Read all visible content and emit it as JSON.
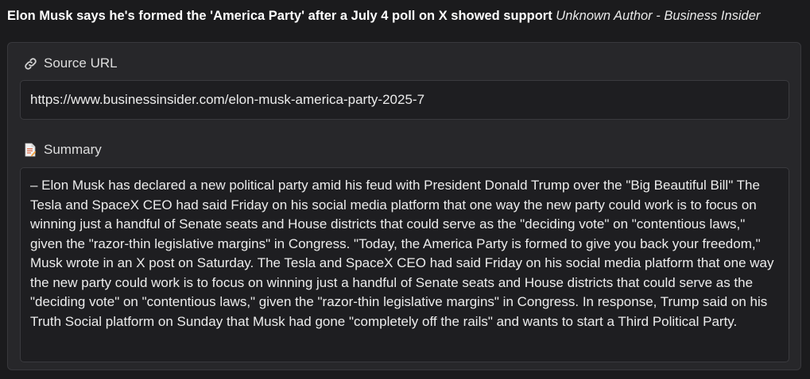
{
  "header": {
    "headline": "Elon Musk says he's formed the 'America Party' after a July 4 poll on X showed support",
    "byline": "Unknown Author - Business Insider"
  },
  "source": {
    "label": "Source URL",
    "icon": "link-icon",
    "url": "https://www.businessinsider.com/elon-musk-america-party-2025-7"
  },
  "summary": {
    "label": "Summary",
    "icon": "document-icon",
    "text": "– Elon Musk has declared a new political party amid his feud with President Donald Trump over the \"Big Beautiful Bill\" The Tesla and SpaceX CEO had said Friday on his social media platform that one way the new party could work is to focus on winning just a handful of Senate seats and House districts that could serve as the \"deciding vote\" on \"contentious laws,\" given the \"razor-thin legislative margins\" in Congress. \"Today, the America Party is formed to give you back your freedom,\" Musk wrote in an X post on Saturday. The Tesla and SpaceX CEO had said Friday on his social media platform that one way the new party could work is to focus on winning just a handful of Senate seats and House districts that could serve as the \"deciding vote\" on \"contentious laws,\" given the \"razor-thin legislative margins\" in Congress. In response, Trump said on his Truth Social platform on Sunday that Musk had gone \"completely off the rails\" and wants to start a Third Political Party."
  }
}
